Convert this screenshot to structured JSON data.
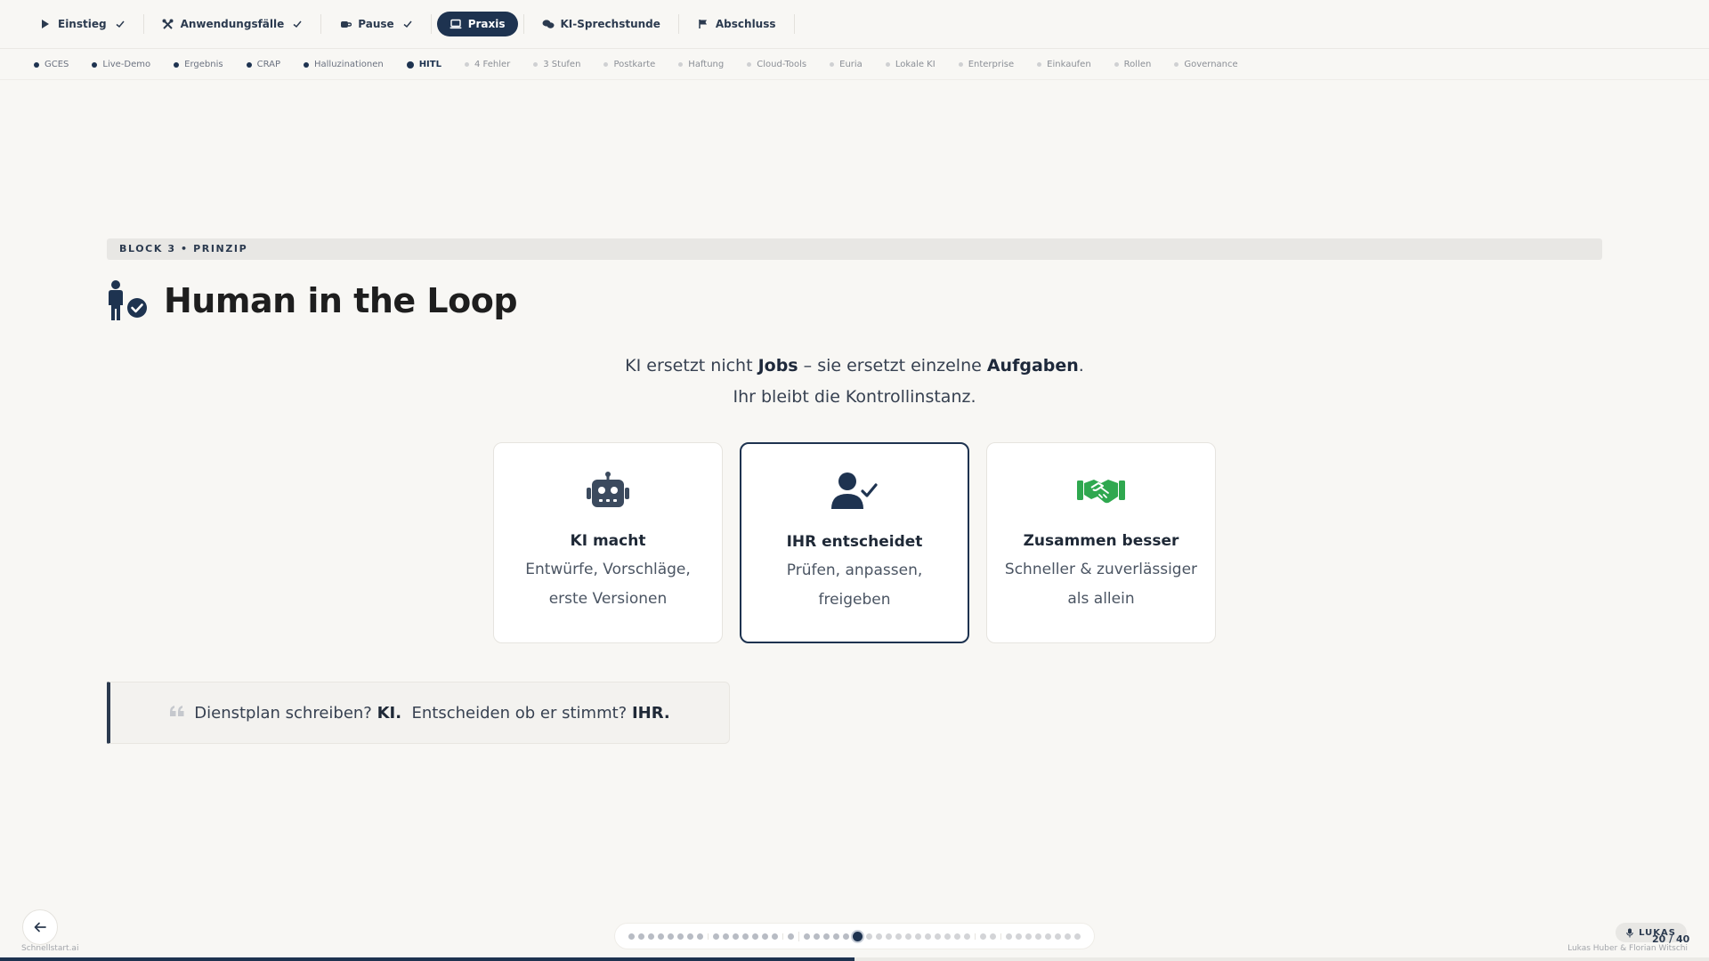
{
  "topnav": {
    "items": [
      {
        "label": "Einstieg",
        "icon": "play-icon",
        "done": true
      },
      {
        "label": "Anwendungsfälle",
        "icon": "tools-icon",
        "done": true
      },
      {
        "label": "Pause",
        "icon": "coffee-icon",
        "done": true
      },
      {
        "label": "Praxis",
        "icon": "laptop-icon",
        "active": true
      },
      {
        "label": "KI-Sprechstunde",
        "icon": "chat-icon"
      },
      {
        "label": "Abschluss",
        "icon": "flag-icon"
      }
    ]
  },
  "subnav": {
    "items": [
      "GCES",
      "Live-Demo",
      "Ergebnis",
      "CRAP",
      "Halluzinationen",
      "HITL",
      "4 Fehler",
      "3 Stufen",
      "Postkarte",
      "Haftung",
      "Cloud-Tools",
      "Euria",
      "Lokale KI",
      "Enterprise",
      "Einkaufen",
      "Rollen",
      "Governance"
    ],
    "current": "HITL"
  },
  "block_label": "BLOCK 3 • PRINZIP",
  "title": "Human in the Loop",
  "intro": {
    "line1_a": "KI ersetzt nicht ",
    "line1_b": "Jobs",
    "line1_c": " – sie ersetzt einzelne ",
    "line1_d": "Aufgaben",
    "line1_e": ".",
    "line2": "Ihr bleibt die Kontrollinstanz."
  },
  "cards": [
    {
      "title": "KI macht",
      "line1": "Entwürfe, Vorschläge,",
      "line2": "erste Versionen",
      "icon": "robot-icon"
    },
    {
      "title": "IHR entscheidet",
      "line1": "Prüfen, anpassen,",
      "line2": "freigeben",
      "icon": "user-check-icon"
    },
    {
      "title": "Zusammen besser",
      "line1": "Schneller & zuverlässiger",
      "line2": "als allein",
      "icon": "handshake-icon"
    }
  ],
  "quote": {
    "part1": "Dienstplan schreiben? ",
    "part2": "KI.",
    "part3": "Entscheiden ob er stimmt? ",
    "part4": "IHR."
  },
  "footer": {
    "brand": "Schnellstart.ai",
    "speaker": "LUKAS",
    "counter": "20 / 40",
    "authors": "Lukas Huber & Florian Witschi",
    "progress": 0.5
  },
  "colors": {
    "accent": "#1e3350",
    "card_icon": "#3b4a5e",
    "handshake": "#2fa84f",
    "background": "#f8f7f4"
  }
}
